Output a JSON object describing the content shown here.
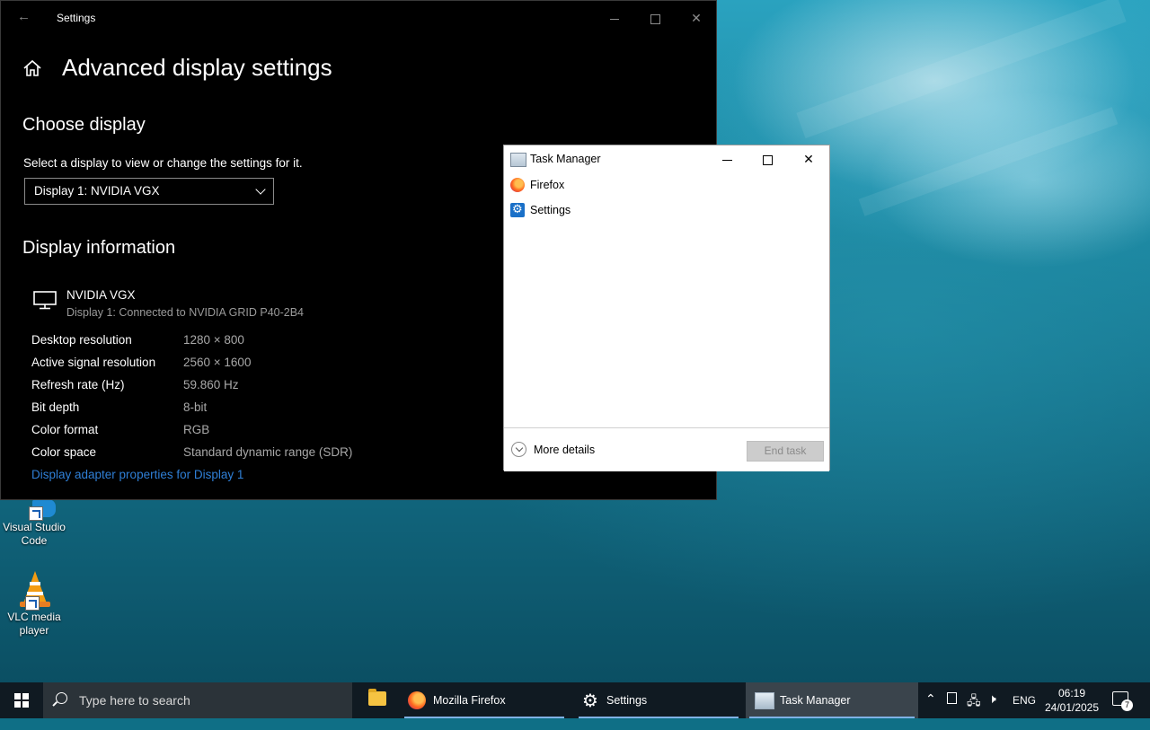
{
  "settings_window": {
    "title": "Settings",
    "page_title": "Advanced display settings",
    "choose_display_heading": "Choose display",
    "choose_display_desc": "Select a display to view or change the settings for it.",
    "display_select_value": "Display 1: NVIDIA VGX",
    "display_info_heading": "Display information",
    "display_name": "NVIDIA VGX",
    "display_connection": "Display 1: Connected to NVIDIA GRID P40-2B4",
    "info_rows": [
      {
        "label": "Desktop resolution",
        "value": "1280 × 800"
      },
      {
        "label": "Active signal resolution",
        "value": "2560 × 1600"
      },
      {
        "label": "Refresh rate (Hz)",
        "value": "59.860 Hz"
      },
      {
        "label": "Bit depth",
        "value": "8-bit"
      },
      {
        "label": "Color format",
        "value": "RGB"
      },
      {
        "label": "Color space",
        "value": "Standard dynamic range (SDR)"
      }
    ],
    "adapter_link": "Display adapter properties for Display 1"
  },
  "task_manager": {
    "title": "Task Manager",
    "apps": [
      {
        "name": "Firefox",
        "icon": "firefox-icon"
      },
      {
        "name": "Settings",
        "icon": "gear-icon"
      }
    ],
    "more_details": "More details",
    "end_task": "End task"
  },
  "desktop_icons": [
    {
      "label": "Visual Studio Code",
      "icon": "vscode-icon"
    },
    {
      "label": "VLC media player",
      "icon": "vlc-icon"
    }
  ],
  "taskbar": {
    "search_placeholder": "Type here to search",
    "items": [
      {
        "label": "Mozilla Firefox",
        "icon": "firefox-icon"
      },
      {
        "label": "Settings",
        "icon": "gear-icon"
      },
      {
        "label": "Task Manager",
        "icon": "task-manager-icon"
      }
    ],
    "language": "ENG",
    "time": "06:19",
    "date": "24/01/2025",
    "notification_count": "7"
  },
  "colors": {
    "settings_bg": "#000000",
    "link": "#2f7fd6",
    "taskbar_bg": "#101a22",
    "taskbar_active": "#7fb2e5"
  }
}
